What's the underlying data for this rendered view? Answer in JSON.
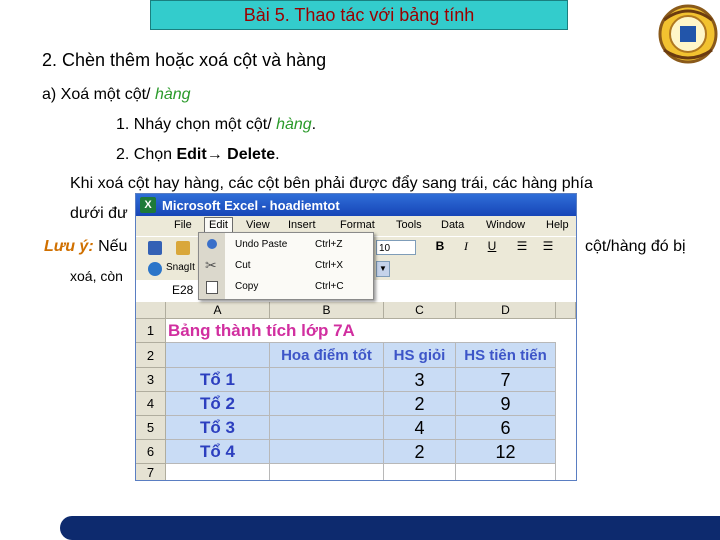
{
  "slide": {
    "title": "Bài 5. Thao tác với bảng tính",
    "heading": "2. Chèn thêm hoặc xoá cột và hàng",
    "sub_a_prefix": "a) Xoá một cột/ ",
    "sub_a_suffix": "hàng",
    "step1_prefix": "1.  Nháy chọn một cột/ ",
    "step1_suffix": "hàng",
    "step1_end": ".",
    "step2_prefix": "2.  Chọn ",
    "step2_edit": "Edit",
    "step2_arrow": "→",
    "step2_delete": " Delete",
    "step2_end": ".",
    "para_line1": "Khi xoá cột hay hàng, các cột bên phải được đẩy sang trái, các hàng phía",
    "para_line2": "dưới đư",
    "note_label": "Lưu ý:",
    "note_start": " Nếu",
    "note_end": "cột/hàng đó bị",
    "note_line2": "xoá, còn"
  },
  "excel": {
    "window_title": "Microsoft Excel - hoadiemtot",
    "menus": [
      "File",
      "Edit",
      "View",
      "Insert",
      "Format",
      "Tools",
      "Data",
      "Window",
      "Help"
    ],
    "font_size": "10",
    "snagit_label": "SnagIt",
    "name_box": "E28",
    "columns": [
      "A",
      "B",
      "C",
      "D"
    ],
    "rows": [
      "1",
      "2",
      "3",
      "4",
      "5",
      "6",
      "7"
    ],
    "cells": {
      "a1": "Bảng thành tích lớp 7A",
      "b2": "Hoa điểm tốt",
      "c2": "HS giỏi",
      "d2": "HS tiên tiến",
      "groups": [
        "Tổ 1",
        "Tổ 2",
        "Tổ 3",
        "Tổ 4"
      ],
      "hs_gioi": [
        "3",
        "2",
        "4",
        "2"
      ],
      "hs_tien_tien": [
        "7",
        "9",
        "6",
        "12"
      ]
    },
    "edit_menu": [
      {
        "label": "Undo Paste",
        "shortcut": "Ctrl+Z"
      },
      {
        "label": "Cut",
        "shortcut": "Ctrl+X"
      },
      {
        "label": "Copy",
        "shortcut": "Ctrl+C"
      }
    ]
  },
  "colors": {
    "title_bg": "#33cccc",
    "title_text": "#9b0000",
    "accent_green": "#2a9a2a",
    "footer": "#0d2a6e"
  }
}
